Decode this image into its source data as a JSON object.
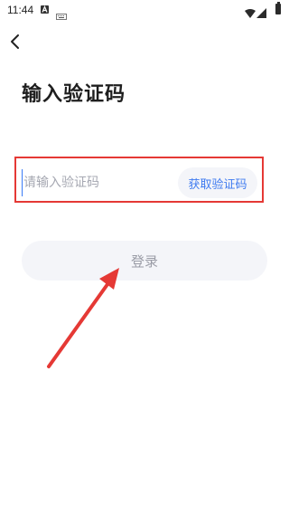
{
  "status_bar": {
    "time": "11:44",
    "icons": [
      "a-badge-icon",
      "keyboard-icon",
      "wifi-icon",
      "signal-icon",
      "battery-icon"
    ]
  },
  "header": {
    "back_icon": "back-arrow-icon",
    "title": "输入验证码"
  },
  "form": {
    "code_input": {
      "value": "",
      "placeholder": "请输入验证码"
    },
    "get_code_label": "获取验证码",
    "login_label": "登录"
  },
  "annotation": {
    "color": "#e53935"
  },
  "colors": {
    "accent": "#3f7bf0",
    "button_bg": "#f4f5f9",
    "disabled_text": "#9a9ca6"
  }
}
